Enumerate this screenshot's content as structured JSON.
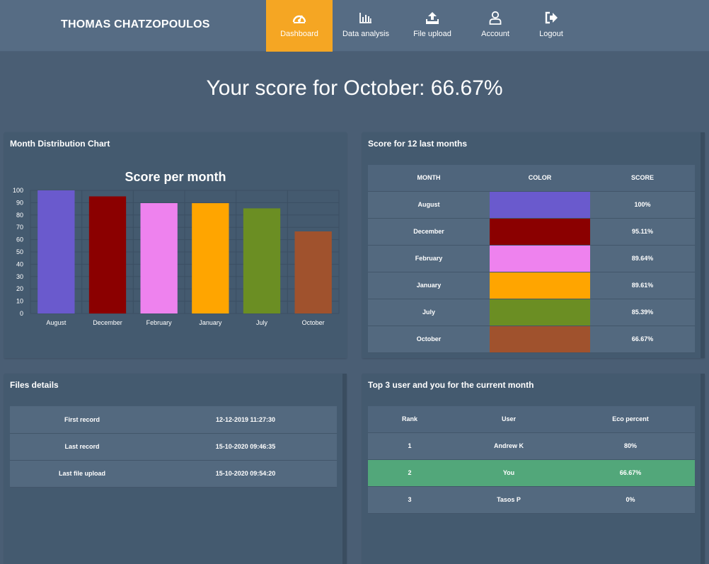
{
  "header": {
    "brand": "THOMAS CHATZOPOULOS",
    "nav": [
      {
        "label": "Dashboard",
        "icon": "dashboard-gauge-icon",
        "active": true
      },
      {
        "label": "Data analysis",
        "icon": "bar-chart-icon",
        "active": false
      },
      {
        "label": "File upload",
        "icon": "upload-icon",
        "active": false
      },
      {
        "label": "Account",
        "icon": "user-icon",
        "active": false
      },
      {
        "label": "Logout",
        "icon": "logout-icon",
        "active": false
      }
    ],
    "accent": "#f5a623"
  },
  "score_heading": "Your score for October: 66.67%",
  "month_chart_panel": {
    "title": "Month Distribution Chart"
  },
  "chart_data": {
    "type": "bar",
    "title": "Score per month",
    "categories": [
      "August",
      "December",
      "February",
      "January",
      "July",
      "October"
    ],
    "values": [
      100,
      95.11,
      89.64,
      89.61,
      85.39,
      66.67
    ],
    "colors": [
      "#6a5acd",
      "#8b0000",
      "#ee82ee",
      "#ffa500",
      "#6b8e23",
      "#a0522d"
    ],
    "ylim": [
      0,
      100
    ],
    "yticks": [
      0,
      10,
      20,
      30,
      40,
      50,
      60,
      70,
      80,
      90,
      100
    ],
    "grid": true,
    "xlabel": "",
    "ylabel": ""
  },
  "months_table": {
    "title": "Score for 12 last months",
    "headers": [
      "MONTH",
      "COLOR",
      "SCORE"
    ],
    "rows": [
      {
        "month": "August",
        "color": "#6a5acd",
        "score": "100%"
      },
      {
        "month": "December",
        "color": "#8b0000",
        "score": "95.11%"
      },
      {
        "month": "February",
        "color": "#ee82ee",
        "score": "89.64%"
      },
      {
        "month": "January",
        "color": "#ffa500",
        "score": "89.61%"
      },
      {
        "month": "July",
        "color": "#6b8e23",
        "score": "85.39%"
      },
      {
        "month": "October",
        "color": "#a0522d",
        "score": "66.67%"
      }
    ]
  },
  "files_details": {
    "title": "Files details",
    "rows": [
      {
        "label": "First record",
        "value": "12-12-2019 11:27:30"
      },
      {
        "label": "Last record",
        "value": "15-10-2020 09:46:35"
      },
      {
        "label": "Last file upload",
        "value": "15-10-2020 09:54:20"
      }
    ]
  },
  "top_users": {
    "title": "Top 3 user and you for the current month",
    "headers": [
      "Rank",
      "User",
      "Eco percent"
    ],
    "rows": [
      {
        "rank": "1",
        "user": "Andrew K",
        "percent": "80%",
        "highlight": false
      },
      {
        "rank": "2",
        "user": "You",
        "percent": "66.67%",
        "highlight": true
      },
      {
        "rank": "3",
        "user": "Tasos P",
        "percent": "0%",
        "highlight": false
      }
    ],
    "highlight_color": "#52a77a"
  }
}
